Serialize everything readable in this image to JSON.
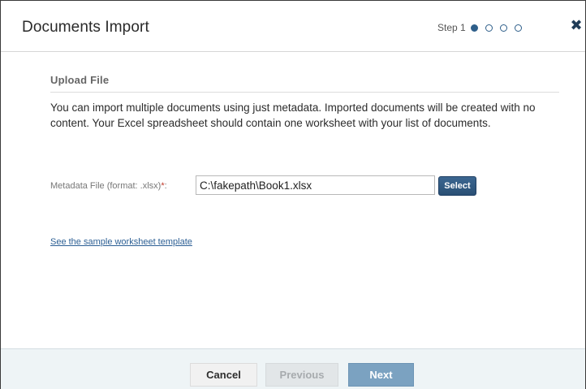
{
  "dialog": {
    "title": "Documents Import",
    "step_label": "Step 1",
    "step_total": 4,
    "step_current": 1,
    "close_icon": "close-icon"
  },
  "section": {
    "title": "Upload File",
    "description": "You can import multiple documents using just metadata. Imported documents will be created with no content. Your Excel spreadsheet should contain one worksheet with your list of documents."
  },
  "metadata_file": {
    "label": "Metadata File (format: .xlsx)",
    "required_mark": "*",
    "colon": ":",
    "value": "C:\\fakepath\\Book1.xlsx",
    "select_label": "Select"
  },
  "sample_link": "See the sample worksheet template",
  "footer": {
    "cancel_label": "Cancel",
    "previous_label": "Previous",
    "next_label": "Next"
  },
  "colors": {
    "accent": "#2e5f8a",
    "next_button": "#7ba2c1",
    "footer_bg": "#eef4f6",
    "link": "#2c5f94"
  }
}
